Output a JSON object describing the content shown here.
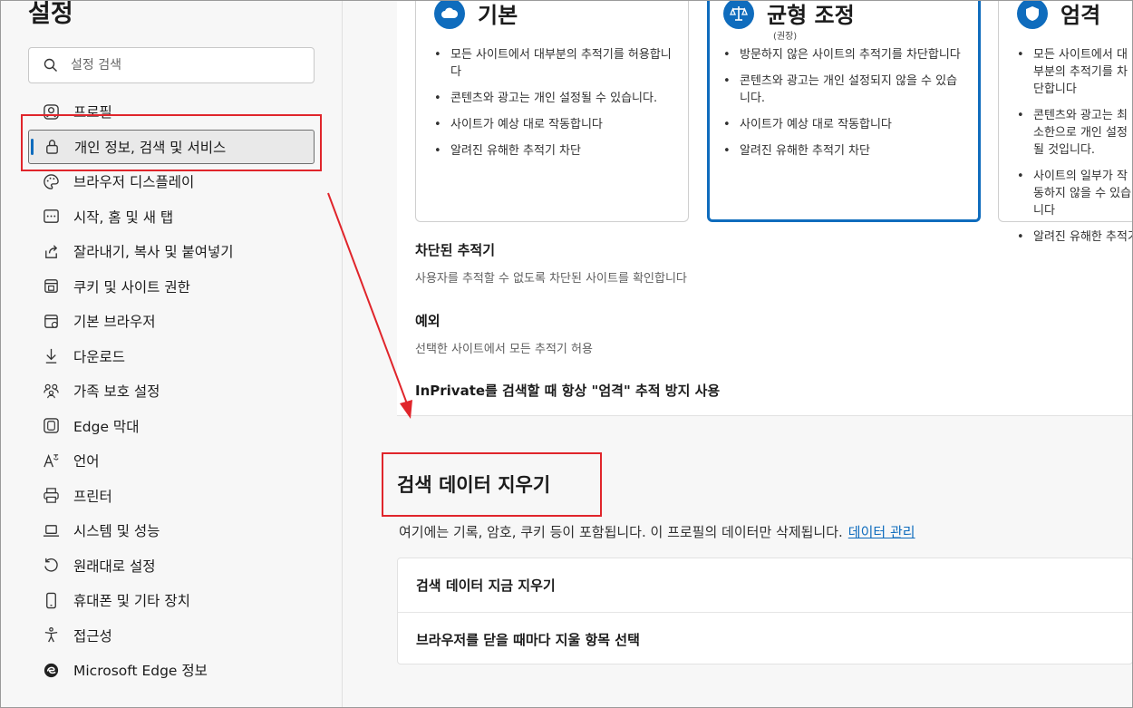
{
  "sidebar": {
    "title": "설정",
    "search_placeholder": "설정 검색",
    "items": [
      {
        "label": "프로필",
        "icon": "profile-icon"
      },
      {
        "label": "개인 정보, 검색 및 서비스",
        "icon": "lock-icon",
        "active": true
      },
      {
        "label": "브라우저 디스플레이",
        "icon": "palette-icon"
      },
      {
        "label": "시작, 홈 및 새 탭",
        "icon": "home-tab-icon"
      },
      {
        "label": "잘라내기, 복사 및 붙여넣기",
        "icon": "share-icon"
      },
      {
        "label": "쿠키 및 사이트 권한",
        "icon": "cookie-icon"
      },
      {
        "label": "기본 브라우저",
        "icon": "browser-icon"
      },
      {
        "label": "다운로드",
        "icon": "download-icon"
      },
      {
        "label": "가족 보호 설정",
        "icon": "family-icon"
      },
      {
        "label": "Edge 막대",
        "icon": "edge-bar-icon"
      },
      {
        "label": "언어",
        "icon": "language-icon"
      },
      {
        "label": "프린터",
        "icon": "printer-icon"
      },
      {
        "label": "시스템 및 성능",
        "icon": "laptop-icon"
      },
      {
        "label": "원래대로 설정",
        "icon": "reset-icon"
      },
      {
        "label": "휴대폰 및 기타 장치",
        "icon": "phone-icon"
      },
      {
        "label": "접근성",
        "icon": "accessibility-icon"
      },
      {
        "label": "Microsoft Edge 정보",
        "icon": "edge-logo-icon"
      }
    ]
  },
  "tracking": {
    "cards": [
      {
        "title": "기본",
        "subtitle": "",
        "bullets": [
          "모든 사이트에서 대부분의 추적기를 허용합니다",
          "콘텐츠와 광고는 개인 설정될 수 있습니다.",
          "사이트가 예상 대로 작동합니다",
          "알려진 유해한 추적기 차단"
        ]
      },
      {
        "title": "균형 조정",
        "subtitle": "(권장)",
        "bullets": [
          "방문하지 않은 사이트의 추적기를 차단합니다",
          "콘텐츠와 광고는 개인 설정되지 않을 수 있습니다.",
          "사이트가 예상 대로 작동합니다",
          "알려진 유해한 추적기 차단"
        ]
      },
      {
        "title": "엄격",
        "subtitle": "",
        "bullets": [
          "모든 사이트에서 대부분의 추적기를 차단합니다",
          "콘텐츠와 광고는 최소한으로 개인 설정될 것입니다.",
          "사이트의 일부가 작동하지 않을 수 있습니다",
          "알려진 유해한 추적기 차단"
        ]
      }
    ],
    "blocked_title": "차단된 추적기",
    "blocked_desc": "사용자를 추적할 수 없도록 차단된 사이트를 확인합니다",
    "exceptions_title": "예외",
    "exceptions_desc": "선택한 사이트에서 모든 추적기 허용",
    "inprivate_title": "InPrivate를 검색할 때 항상 \"엄격\" 추적 방지 사용"
  },
  "clear_data": {
    "title": "검색 데이터 지우기",
    "desc": "여기에는 기록, 암호, 쿠키 등이 포함됩니다. 이 프로필의 데이터만 삭제됩니다.",
    "link": "데이터 관리",
    "rows": [
      "검색 데이터 지금 지우기",
      "브라우저를 닫을 때마다 지울 항목 선택"
    ]
  },
  "colors": {
    "accent": "#0f6cbd",
    "highlight_red": "#e0252b"
  }
}
